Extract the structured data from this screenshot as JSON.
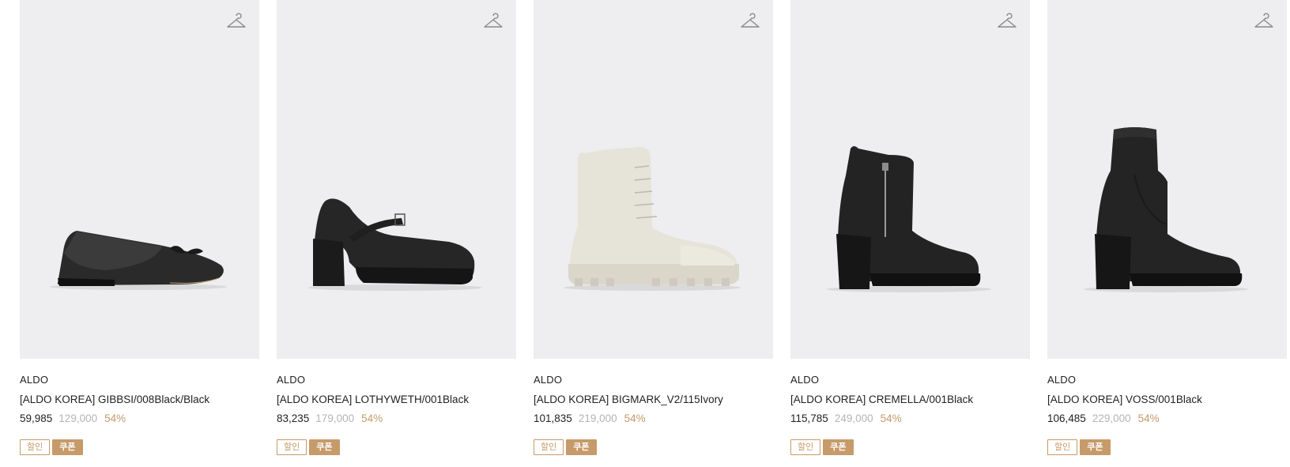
{
  "products": [
    {
      "brand": "ALDO",
      "name": "[ALDO KOREA] GIBBSI/008Black/Black",
      "sale_price": "59,985",
      "original_price": "129,000",
      "discount": "54%",
      "badges": [
        "할인",
        "쿠폰"
      ],
      "image_icon": "flat-shoe"
    },
    {
      "brand": "ALDO",
      "name": "[ALDO KOREA] LOTHYWETH/001Black",
      "sale_price": "83,235",
      "original_price": "179,000",
      "discount": "54%",
      "badges": [
        "할인",
        "쿠폰"
      ],
      "image_icon": "mary-jane-heel"
    },
    {
      "brand": "ALDO",
      "name": "[ALDO KOREA] BIGMARK_V2/115Ivory",
      "sale_price": "101,835",
      "original_price": "219,000",
      "discount": "54%",
      "badges": [
        "할인",
        "쿠폰"
      ],
      "image_icon": "lace-up-boot"
    },
    {
      "brand": "ALDO",
      "name": "[ALDO KOREA] CREMELLA/001Black",
      "sale_price": "115,785",
      "original_price": "249,000",
      "discount": "54%",
      "badges": [
        "할인",
        "쿠폰"
      ],
      "image_icon": "zip-ankle-boot"
    },
    {
      "brand": "ALDO",
      "name": "[ALDO KOREA] VOSS/001Black",
      "sale_price": "106,485",
      "original_price": "229,000",
      "discount": "54%",
      "badges": [
        "할인",
        "쿠폰"
      ],
      "image_icon": "sock-ankle-boot"
    }
  ],
  "colors": {
    "image_bg": "#eeedef",
    "accent": "#c69a69",
    "original_price": "#b4b4b4",
    "text": "#222222"
  }
}
